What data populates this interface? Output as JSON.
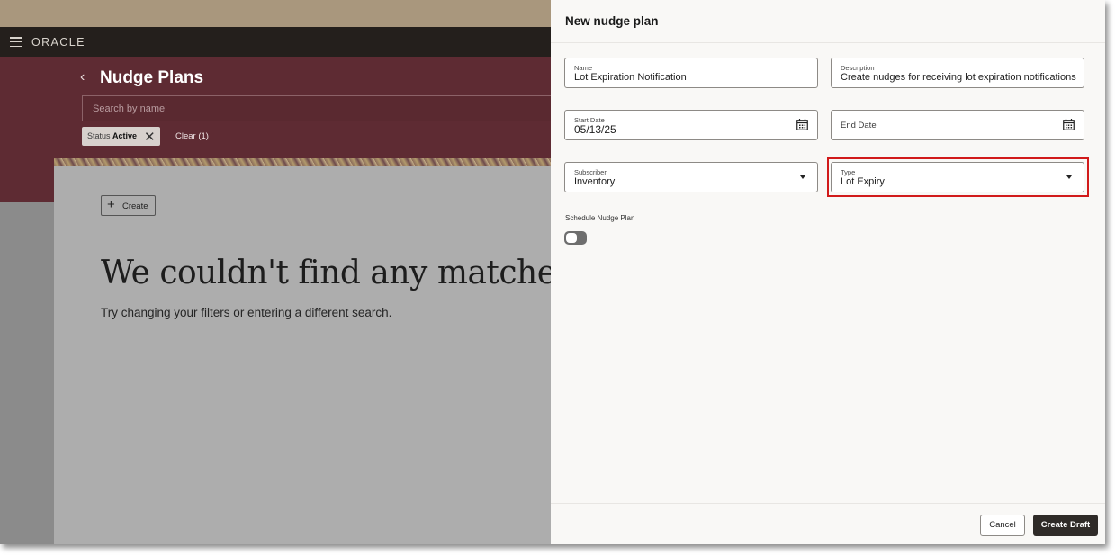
{
  "app": {
    "logo": "ORACLE"
  },
  "page": {
    "title": "Nudge Plans",
    "back_glyph": "‹",
    "search_placeholder": "Search by name",
    "filter_chip": {
      "label": "Status",
      "value": "Active",
      "remove_glyph": "✕"
    },
    "clear_label": "Clear (1)",
    "create_label": "Create",
    "create_glyph": "+",
    "empty_title": "We couldn't find any matches.",
    "empty_hint": "Try changing your filters or entering a different search."
  },
  "drawer": {
    "title": "New nudge plan",
    "fields": {
      "name": {
        "label": "Name",
        "value": "Lot Expiration Notification"
      },
      "description": {
        "label": "Description",
        "value": "Create nudges for receiving lot expiration notifications"
      },
      "start_date": {
        "label": "Start Date",
        "value": "05/13/25",
        "icon": "calendar-icon"
      },
      "end_date": {
        "label": "End Date",
        "value": "",
        "icon": "calendar-icon"
      },
      "subscriber": {
        "label": "Subscriber",
        "value": "Inventory"
      },
      "type": {
        "label": "Type",
        "value": "Lot Expiry"
      }
    },
    "schedule_label": "Schedule Nudge Plan",
    "schedule_enabled": false,
    "cancel_label": "Cancel",
    "create_draft_label": "Create Draft"
  },
  "colors": {
    "appbar": "#241f1c",
    "header_band": "#5e2b33",
    "highlight": "#d11a1a",
    "primary_button": "#2f2b28"
  }
}
